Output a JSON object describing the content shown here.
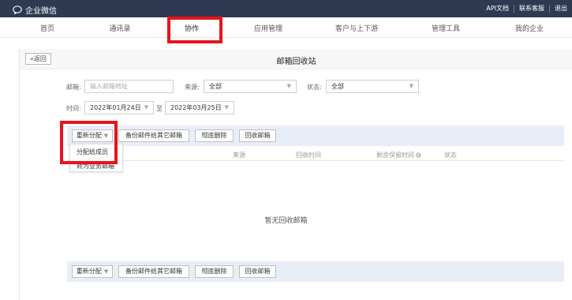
{
  "app": {
    "logo_text": "企业微信"
  },
  "top_links": [
    "API文档",
    "联系客服",
    "退出"
  ],
  "nav": {
    "items": [
      {
        "label": "首页"
      },
      {
        "label": "通讯录"
      },
      {
        "label": "协作"
      },
      {
        "label": "应用管理"
      },
      {
        "label": "客户与上下游"
      },
      {
        "label": "管理工具"
      },
      {
        "label": "我的企业"
      }
    ],
    "active": "协作"
  },
  "page": {
    "back_label": "«返回",
    "title": "邮箱回收站"
  },
  "filters": {
    "mailbox_label": "邮箱:",
    "mailbox_placeholder": "输入邮箱地址",
    "source_label": "来源:",
    "source_value": "全部",
    "status_label": "状态:",
    "status_value": "全部",
    "time_label": "时间:",
    "date_from": "2022年01月24日",
    "to_label": "至",
    "date_to": "2022年03月25日"
  },
  "toolbar": {
    "reassign_label": "重新分配",
    "backup_label": "备份邮件给其它邮箱",
    "delete_label": "彻底删除",
    "recover_label": "回收邮箱"
  },
  "dropdown": {
    "items": [
      "分配给成员",
      "转为业务邮箱"
    ]
  },
  "table": {
    "headers": [
      "来源",
      "回收时间",
      "剩余保留时间",
      "状态"
    ],
    "empty_message": "暂无回收邮箱"
  },
  "colors": {
    "topbar": "#2e3a52",
    "toolbar": "#e8eef8",
    "highlight": "#e8141a"
  }
}
